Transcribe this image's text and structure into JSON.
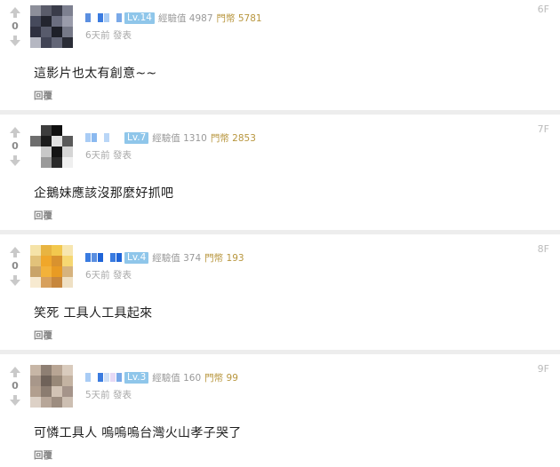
{
  "comments": [
    {
      "floor": "6F",
      "votes": "0",
      "level": "Lv.14",
      "exp": "經驗值 4987",
      "coins": "門幣 5781",
      "time": "6天前 發表",
      "content": "這影片也太有創意~~",
      "reply": "回覆",
      "name_colors": [
        "#5b8fe0",
        "#ffffff",
        "#3a7be0",
        "#a9ccf5",
        "#ffffff",
        "#7aa9e8"
      ],
      "avatar": [
        "#8d8f9a",
        "#5a5c6a",
        "#3a3c4a",
        "#7d8090",
        "#464a5c",
        "#23252f",
        "#6b6e80",
        "#9a9cab",
        "#2f3140",
        "#585b6c",
        "#1e2029",
        "#767988",
        "#b5b7c2",
        "#414455",
        "#636677",
        "#2a2c36"
      ]
    },
    {
      "floor": "7F",
      "votes": "0",
      "level": "Lv.7",
      "exp": "經驗值 1310",
      "coins": "門幣 2853",
      "time": "6天前 發表",
      "content": "企鵝妹應該沒那麼好抓吧",
      "reply": "回覆",
      "name_colors": [
        "#a9ccf5",
        "#8ab9f0",
        "#ffffff",
        "#b9d6f7",
        "#ffffff",
        "#ffffff"
      ],
      "avatar": [
        "#ffffff",
        "#3d3d3d",
        "#0f0f0f",
        "#ffffff",
        "#6e6e6e",
        "#1b1b1b",
        "#e0e0e0",
        "#5a5a5a",
        "#ffffff",
        "#c8c8c8",
        "#141414",
        "#d5d5d5",
        "#ffffff",
        "#9a9a9a",
        "#2a2a2a",
        "#efefef"
      ]
    },
    {
      "floor": "8F",
      "votes": "0",
      "level": "Lv.4",
      "exp": "經驗值 374",
      "coins": "門幣 193",
      "time": "6天前 發表",
      "content": "笑死 工具人工具起來",
      "reply": "回覆",
      "name_colors": [
        "#3a7be0",
        "#5b8fe0",
        "#1f64d8",
        "#ffffff",
        "#3a7be0",
        "#1f64d8"
      ],
      "avatar": [
        "#f5e3a8",
        "#e8b441",
        "#f2c84e",
        "#f7e6b0",
        "#e2c27a",
        "#f0a72a",
        "#d9922e",
        "#f6d772",
        "#c9a469",
        "#f3b23a",
        "#e89b24",
        "#d6b37e",
        "#f7ead0",
        "#d7a05c",
        "#c7873d",
        "#efe0c4"
      ]
    },
    {
      "floor": "9F",
      "votes": "0",
      "level": "Lv.3",
      "exp": "經驗值 160",
      "coins": "門幣 99",
      "time": "5天前 發表",
      "content": "可憐工具人 嗚嗚嗚台灣火山孝子哭了",
      "reply": "回覆",
      "name_colors": [
        "#a9ccf5",
        "#ffffff",
        "#3a7be0",
        "#cfe0f7",
        "#e6d9f5",
        "#7aa9e8"
      ],
      "avatar": [
        "#c7b6a6",
        "#8e7f73",
        "#b8a594",
        "#d9cbbd",
        "#a8978a",
        "#6f6259",
        "#988878",
        "#c4b3a2",
        "#b29f8f",
        "#8b7c70",
        "#d2c3b5",
        "#a5948a",
        "#ddd1c6",
        "#b7a698",
        "#9d8d80",
        "#cdbfb2"
      ]
    }
  ]
}
